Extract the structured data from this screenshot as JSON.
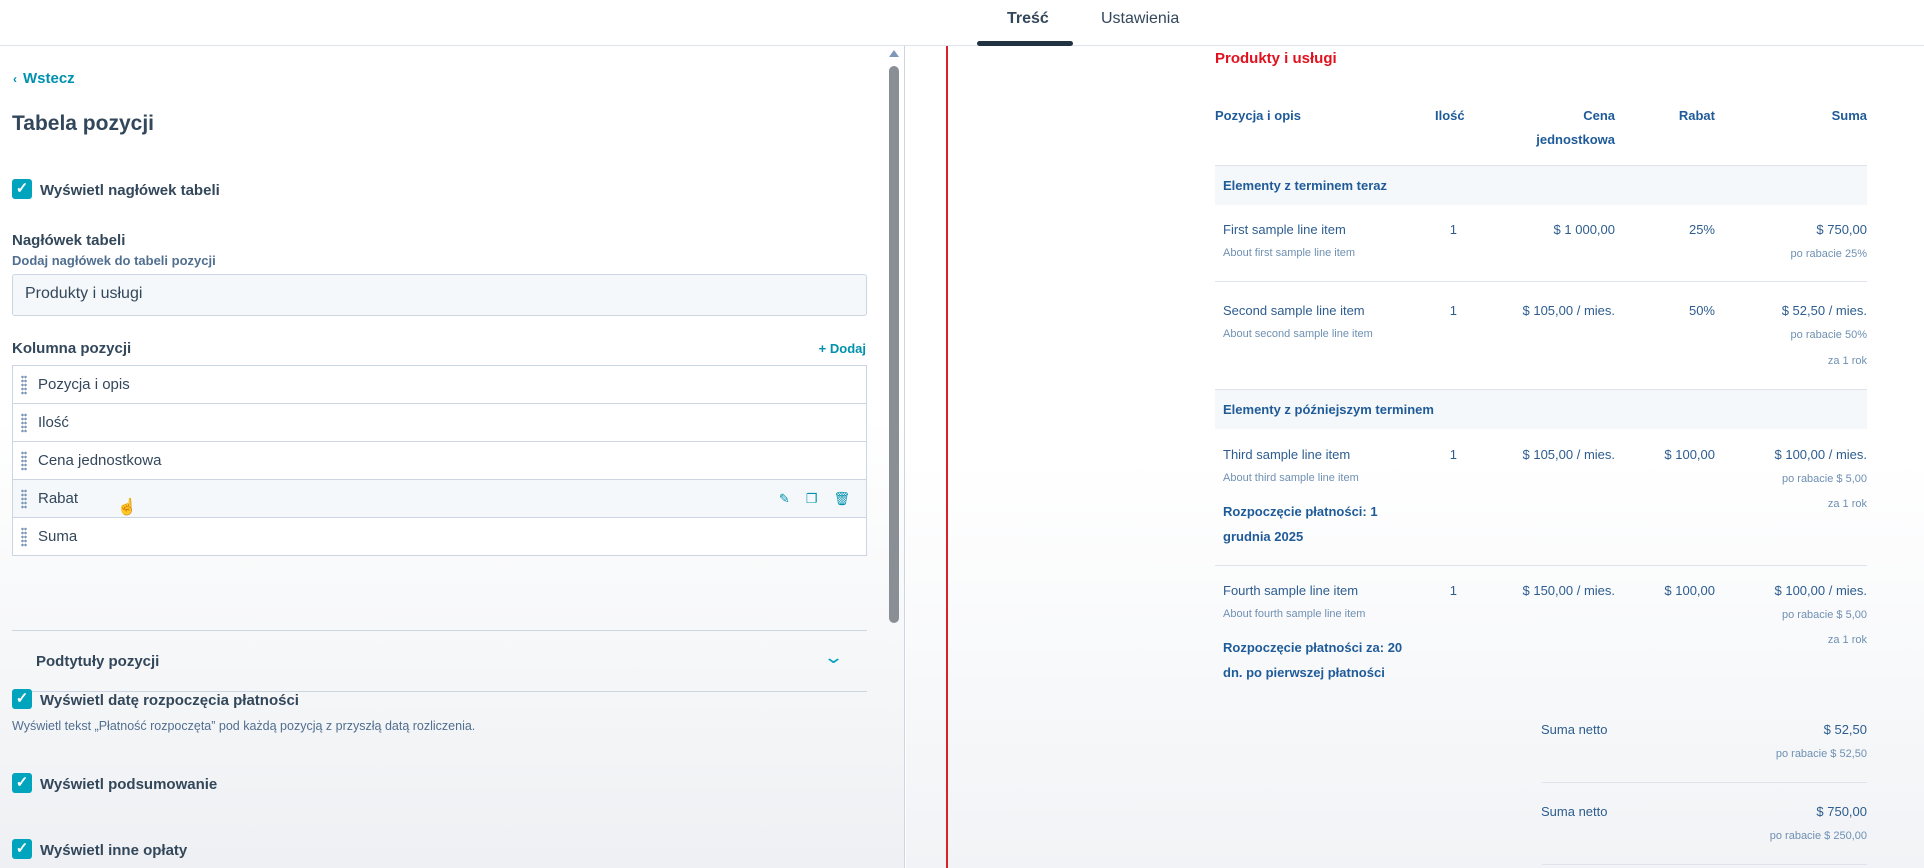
{
  "tabs": [
    {
      "label": "Treść",
      "active": true
    },
    {
      "label": "Ustawienia",
      "active": false
    }
  ],
  "sidebar": {
    "back_label": "Wstecz",
    "title": "Tabela pozycji",
    "show_header": {
      "label": "Wyświetl nagłówek tabeli",
      "checked": true
    },
    "header_field": {
      "label": "Nagłówek tabeli",
      "help": "Dodaj nagłówek do tabeli pozycji",
      "value": "Produkty i usługi"
    },
    "columns": {
      "label": "Kolumna pozycji",
      "add_label": "+ Dodaj",
      "items": [
        {
          "label": "Pozycja i opis"
        },
        {
          "label": "Ilość"
        },
        {
          "label": "Cena jednostkowa"
        },
        {
          "label": "Rabat"
        },
        {
          "label": "Suma"
        }
      ]
    },
    "subtitles_label": "Podtytuły pozycji",
    "show_start_date": {
      "label": "Wyświetl datę rozpoczęcia płatności",
      "help": "Wyświetl tekst „Płatność rozpoczęta” pod każdą pozycją z przyszłą datą rozliczenia.",
      "checked": true
    },
    "show_summary": {
      "label": "Wyświetl podsumowanie",
      "checked": true
    },
    "show_other_fees": {
      "label": "Wyświetl inne opłaty",
      "checked": true
    }
  },
  "preview": {
    "title": "Produkty i usługi",
    "headers": {
      "item": "Pozycja i opis",
      "qty": "Ilość",
      "unit_price_1": "Cena",
      "unit_price_2": "jednostkowa",
      "discount": "Rabat",
      "total": "Suma"
    },
    "sections": [
      {
        "title": "Elementy z terminem teraz",
        "rows": [
          {
            "name": "First sample line item",
            "desc": "About first sample line item",
            "qty": "1",
            "price": "$ 1 000,00",
            "discount": "25%",
            "total": "$ 750,00",
            "total_sub": "po rabacie 25%"
          },
          {
            "name": "Second sample line item",
            "desc": "About second sample line item",
            "qty": "1",
            "price": "$ 105,00 / mies.",
            "discount": "50%",
            "total": "$ 52,50 / mies.",
            "total_sub": "po rabacie 50%",
            "total_sub2": "za 1 rok"
          }
        ]
      },
      {
        "title": "Elementy z późniejszym terminem",
        "rows": [
          {
            "name": "Third sample line item",
            "desc": "About third sample line item",
            "qty": "1",
            "price": "$ 105,00 / mies.",
            "discount": "$ 100,00",
            "total": "$ 100,00 / mies.",
            "total_sub": "po rabacie $ 5,00",
            "total_sub2": "za 1 rok",
            "note_1": "Rozpoczęcie płatności: 1",
            "note_2": "grudnia 2025"
          },
          {
            "name": "Fourth sample line item",
            "desc": "About fourth sample line item",
            "qty": "1",
            "price": "$ 150,00 / mies.",
            "discount": "$ 100,00",
            "total": "$ 100,00 / mies.",
            "total_sub": "po rabacie $ 5,00",
            "total_sub2": "za 1 rok",
            "note_1": "Rozpoczęcie płatności za: 20",
            "note_2": "dn. po pierwszej płatności"
          }
        ]
      }
    ],
    "summary": [
      {
        "label": "Suma netto",
        "value": "$ 52,50",
        "sub": "po rabacie $ 52,50"
      },
      {
        "label": "Suma netto",
        "value": "$ 750,00",
        "sub": "po rabacie $ 250,00"
      }
    ]
  },
  "colors": {
    "accent": "#00a4bd",
    "link": "#0091ae",
    "preview_title": "#e0121f",
    "preview_text": "#1f5b99"
  }
}
